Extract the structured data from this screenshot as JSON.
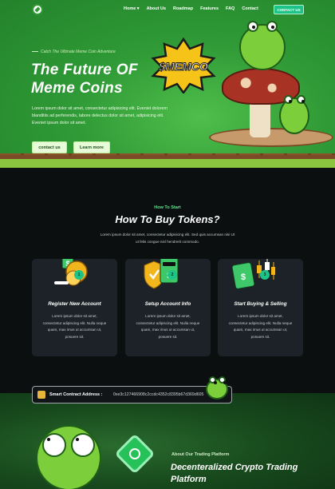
{
  "nav": {
    "links": [
      "Home ▾",
      "About Us",
      "Roadmap",
      "Features",
      "FAQ",
      "Contact"
    ],
    "contact_button": "CONTACT US"
  },
  "hero": {
    "kicker": "Catch The Ultimate Meme Coin Adventure",
    "title": "The Future OF Meme Coins",
    "badge": "$MEMCO",
    "description": "Lorem ipsum dolor sit amet, consectetur adipisicing elit. Eveniet dolorem blanditiis ad perferendis, labore delectus dolor sit amet, adipisicing elit. Eveniet ipsum dolor sit amet.",
    "button_contact": "contact us",
    "button_learn": "Learn more"
  },
  "how": {
    "kicker": "How To Start",
    "title": "How To Buy Tokens?",
    "description": "Lorem ipsum dolor sit amet, consectetur adipisicing elit. Sed quis accumsan nisi Ut ut felis congue nisl hendrerit commodo."
  },
  "cards": [
    {
      "num": "1",
      "title": "Register New Account",
      "text": "Lorem ipsum dolor sit amet, consectetur adipiscing elit. Nulla neque quam, max imus ut accumsan ut, posuere sit."
    },
    {
      "num": "2",
      "title": "Setup Account Info",
      "text": "Lorem ipsum dolor sit amet, consectetur adipiscing elit. Nulla neque quam, max imus ut accumsan ut, posuere sit."
    },
    {
      "num": "3",
      "title": "Start Buying & Selling",
      "text": "Lorem ipsum dolor sit amet, consectetur adipiscing elit. Nulla neque quam, max imus ut accumsan ut, posuere sit."
    }
  ],
  "contract": {
    "label": "Smart Contract Address :",
    "address": "0xe3c127466908c2ccdc4352c8395b67d369d605"
  },
  "about": {
    "kicker": "About Our Trading Platform",
    "title": "Decenteralized Crypto Trading Platform"
  },
  "colors": {
    "accent": "#1dc488",
    "hero_green": "#2f9a36",
    "dark_bg": "#0b0f10"
  }
}
